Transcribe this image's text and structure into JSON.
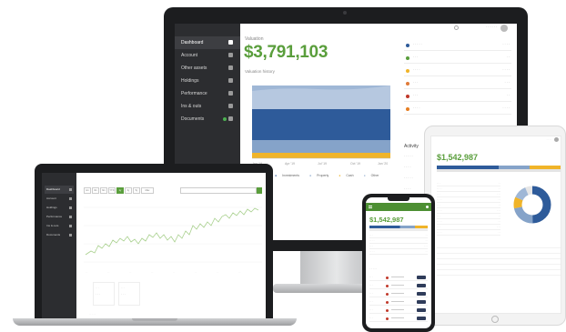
{
  "desktop": {
    "sidebar": {
      "items": [
        {
          "label": "Dashboard",
          "active": true
        },
        {
          "label": "Account"
        },
        {
          "label": "Other assets"
        },
        {
          "label": "Holdings"
        },
        {
          "label": "Performance"
        },
        {
          "label": "Ins & outs"
        },
        {
          "label": "Documents"
        }
      ]
    },
    "valuation_label": "Valuation",
    "valuation": "$3,791,103",
    "history_label": "Valuation history",
    "chart_data": {
      "type": "area",
      "x": [
        "Jan '19",
        "Apr '19",
        "Jul '19",
        "Oct '19",
        "Jan '20"
      ],
      "series": [
        {
          "name": "Investments",
          "color": "#2e5b9a",
          "values": [
            0.55,
            0.55,
            0.55,
            0.55,
            0.55
          ]
        },
        {
          "name": "Property",
          "color": "#85a3c9",
          "values": [
            0.25,
            0.25,
            0.25,
            0.25,
            0.25
          ]
        },
        {
          "name": "Cash",
          "color": "#f0b429",
          "values": [
            0.05,
            0.05,
            0.05,
            0.05,
            0.05
          ]
        },
        {
          "name": "Other",
          "color": "#9fb7d6",
          "values": [
            0.15,
            0.15,
            0.15,
            0.15,
            0.15
          ]
        }
      ]
    },
    "activity_title": "Activity"
  },
  "laptop": {
    "tabs": [
      "1m",
      "3m",
      "6m",
      "YTD",
      "1y",
      "3y",
      "5y",
      "Max"
    ],
    "active_tab": "1y"
  },
  "tablet": {
    "valuation": "$1,542,987"
  },
  "phone": {
    "valuation": "$1,542,987"
  },
  "colors": {
    "brand_green": "#5a9e3c",
    "sidebar": "#2c2d30",
    "primary_blue": "#2e5b9a",
    "light_blue": "#85a3c9",
    "gold": "#f0b429"
  }
}
